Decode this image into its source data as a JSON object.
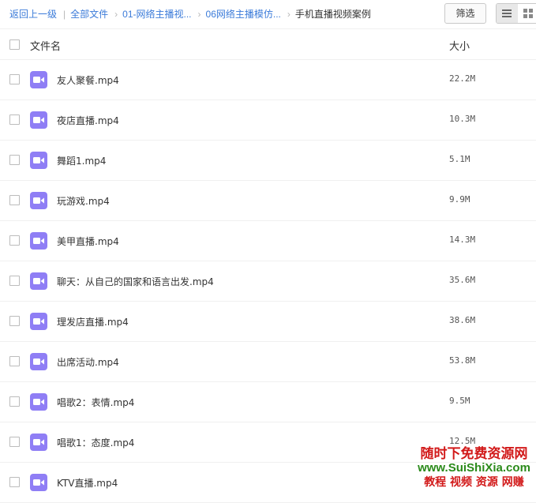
{
  "breadcrumb": {
    "back": "返回上一级",
    "items": [
      "全部文件",
      "01-网络主播视...",
      "06网络主播模仿..."
    ],
    "current": "手机直播视频案例"
  },
  "toolbar": {
    "filter_label": "筛选"
  },
  "table": {
    "col_name": "文件名",
    "col_size": "大小",
    "rows": [
      {
        "name": "友人聚餐.mp4",
        "size": "22.2M"
      },
      {
        "name": "夜店直播.mp4",
        "size": "10.3M"
      },
      {
        "name": "舞蹈1.mp4",
        "size": "5.1M"
      },
      {
        "name": "玩游戏.mp4",
        "size": "9.9M"
      },
      {
        "name": "美甲直播.mp4",
        "size": "14.3M"
      },
      {
        "name": "聊天：从自己的国家和语言出发.mp4",
        "size": "35.6M"
      },
      {
        "name": "理发店直播.mp4",
        "size": "38.6M"
      },
      {
        "name": "出席活动.mp4",
        "size": "53.8M"
      },
      {
        "name": "唱歌2：表情.mp4",
        "size": "9.5M"
      },
      {
        "name": "唱歌1：态度.mp4",
        "size": "12.5M"
      },
      {
        "name": "KTV直播.mp4",
        "size": ""
      }
    ]
  },
  "watermark": {
    "line1": "随时下免费资源网",
    "line2": "www.SuiShiXia.com",
    "line3": "教程 视频 资源 网赚"
  },
  "icon_names": {
    "video": "video-file-icon",
    "list": "list-view-icon",
    "grid": "grid-view-icon"
  },
  "colors": {
    "link": "#3b7bd9",
    "icon": "#8f7ef5"
  }
}
